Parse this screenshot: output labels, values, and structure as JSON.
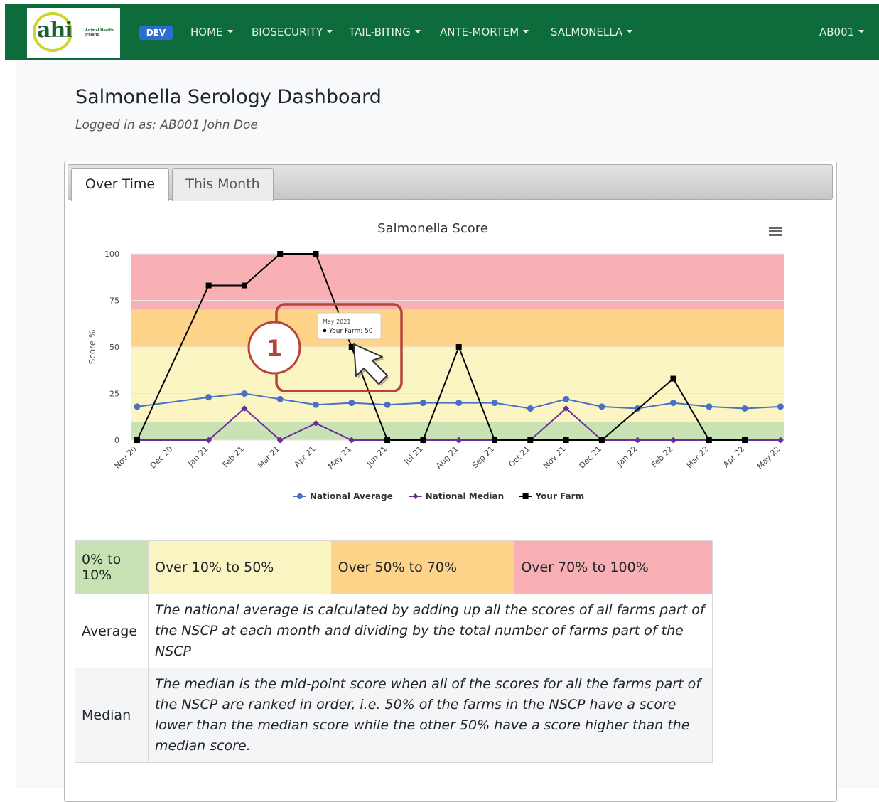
{
  "nav": {
    "logo_text": "ahi",
    "logo_subtext": "Animal Health Ireland",
    "badge": "DEV",
    "items": [
      "HOME",
      "BIOSECURITY",
      "TAIL-BITING",
      "ANTE-MORTEM",
      "SALMONELLA"
    ],
    "user": "AB001"
  },
  "header": {
    "title": "Salmonella Serology Dashboard",
    "logged_in": "Logged in as: AB001 John Doe"
  },
  "tabs": [
    "Over Time",
    "This Month"
  ],
  "chart_data": {
    "type": "line",
    "title": "Salmonella Score",
    "ylabel": "Score %",
    "ylim": [
      0,
      100
    ],
    "yticks": [
      0,
      25,
      50,
      75,
      100
    ],
    "categories": [
      "Nov 20",
      "Dec 20",
      "Jan 21",
      "Feb 21",
      "Mar 21",
      "Apr 21",
      "May 21",
      "Jun 21",
      "Jul 21",
      "Aug 21",
      "Sep 21",
      "Oct 21",
      "Nov 21",
      "Dec 21",
      "Jan 22",
      "Feb 22",
      "Mar 22",
      "Apr 22",
      "May 22"
    ],
    "bands": [
      {
        "from": 0,
        "to": 10,
        "color": "#c8e2b4"
      },
      {
        "from": 10,
        "to": 50,
        "color": "#fbf5c4"
      },
      {
        "from": 50,
        "to": 70,
        "color": "#fdd489"
      },
      {
        "from": 70,
        "to": 100,
        "color": "#f8b0b5"
      }
    ],
    "series": [
      {
        "name": "National Average",
        "color": "#4a6fc7",
        "marker": "circle",
        "values": [
          18,
          null,
          23,
          25,
          22,
          19,
          20,
          19,
          20,
          20,
          20,
          17,
          22,
          18,
          17,
          20,
          18,
          17,
          18
        ]
      },
      {
        "name": "National Median",
        "color": "#6a2d9a",
        "marker": "diamond",
        "values": [
          0,
          null,
          0,
          17,
          0,
          9,
          0,
          0,
          0,
          0,
          0,
          0,
          17,
          0,
          0,
          0,
          0,
          0,
          0
        ]
      },
      {
        "name": "Your Farm",
        "color": "#000000",
        "marker": "square",
        "values": [
          0,
          null,
          83,
          83,
          100,
          100,
          50,
          0,
          0,
          50,
          0,
          0,
          0,
          0,
          null,
          33,
          0,
          0,
          null
        ]
      }
    ],
    "legend_position": "bottom-center",
    "tooltip": {
      "month": "May 2021",
      "label": "Your Farm: 50"
    },
    "callout": "1"
  },
  "legend_table": {
    "bands": [
      "0% to 10%",
      "Over 10% to 50%",
      "Over 50% to 70%",
      "Over 70% to 100%"
    ],
    "band_colors": [
      "#c8e2b4",
      "#fbf5c4",
      "#fdd489",
      "#f8b0b5"
    ],
    "rows": [
      {
        "label": "Average",
        "text": "The national average is calculated by adding up all the scores of all farms part of the NSCP at each month and dividing by the total number of farms part of the NSCP"
      },
      {
        "label": "Median",
        "text": "The median is the mid-point score when all of the scores for all the farms part of the NSCP are ranked in order, i.e. 50% of the farms in the NSCP have a score lower than the median score while the other 50% have a score higher than the median score."
      }
    ]
  }
}
